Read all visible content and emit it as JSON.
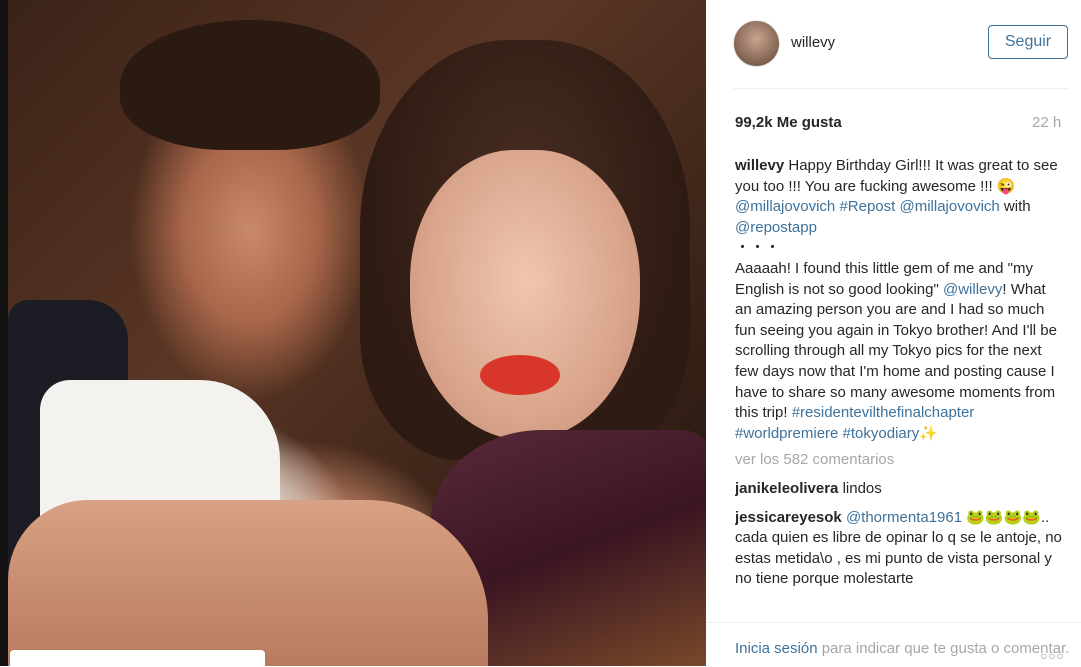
{
  "post": {
    "username": "willevy",
    "follow_label": "Seguir",
    "likes": "99,2k Me gusta",
    "time": "22 h"
  },
  "caption": {
    "username": "willevy",
    "line1": "Happy Birthday Girl!!! It was great to see you too !!! You are fucking awesome !!! 😜 ",
    "tag1": "@millajovovich",
    "tag2": "#Repost",
    "tag3": "@millajovovich",
    "with": " with ",
    "tag4": "@repostapp",
    "dots": "・・・",
    "body1": "Aaaaah! I found this little gem of me and \"my English is not so good looking\" ",
    "tag5": "@willevy",
    "body2": "! What an amazing person you are and I had so much fun seeing you again in Tokyo brother! And I'll be scrolling through all my Tokyo pics for the next few days now that I'm home and posting cause I have to share so many awesome moments from this trip! ",
    "tag6": "#residentevilthefinalchapter",
    "tag7": "#worldpremiere",
    "tag8": "#tokyodiary",
    "sparkle": "✨"
  },
  "view_all": "ver los 582 comentarios",
  "comments": [
    {
      "user": "janikeleolivera",
      "text": "lindos"
    },
    {
      "user": "jessicareyesok",
      "mention": "@thormenta1961",
      "text": " 🐸🐸🐸🐸.. cada quien es libre de opinar lo q se le antoje, no estas metida\\o , es mi punto de vista personal y no tiene porque molestarte"
    }
  ],
  "footer": {
    "login": "Inicia sesión",
    "rest": " para indicar que te gusta o comentar.",
    "more": "○○○"
  }
}
